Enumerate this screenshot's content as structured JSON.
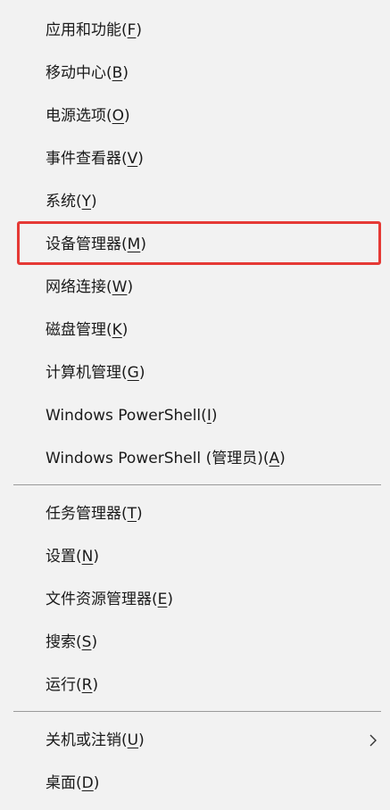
{
  "menu": {
    "group1": [
      {
        "label": "应用和功能",
        "key": "F"
      },
      {
        "label": "移动中心",
        "key": "B"
      },
      {
        "label": "电源选项",
        "key": "O"
      },
      {
        "label": "事件查看器",
        "key": "V"
      },
      {
        "label": "系统",
        "key": "Y"
      },
      {
        "label": "设备管理器",
        "key": "M"
      },
      {
        "label": "网络连接",
        "key": "W"
      },
      {
        "label": "磁盘管理",
        "key": "K"
      },
      {
        "label": "计算机管理",
        "key": "G"
      },
      {
        "label": "Windows PowerShell",
        "key": "I"
      },
      {
        "label": "Windows PowerShell (管理员)",
        "key": "A"
      }
    ],
    "group2": [
      {
        "label": "任务管理器",
        "key": "T"
      },
      {
        "label": "设置",
        "key": "N"
      },
      {
        "label": "文件资源管理器",
        "key": "E"
      },
      {
        "label": "搜索",
        "key": "S"
      },
      {
        "label": "运行",
        "key": "R"
      }
    ],
    "group3": [
      {
        "label": "关机或注销",
        "key": "U",
        "has_submenu": true
      },
      {
        "label": "桌面",
        "key": "D"
      }
    ]
  },
  "colors": {
    "background": "#f2f2f2",
    "highlight_border": "#e53935",
    "separator": "#9a9a9a",
    "text": "#1a1a1a"
  },
  "icons": {
    "submenu": "chevron-right-icon"
  }
}
